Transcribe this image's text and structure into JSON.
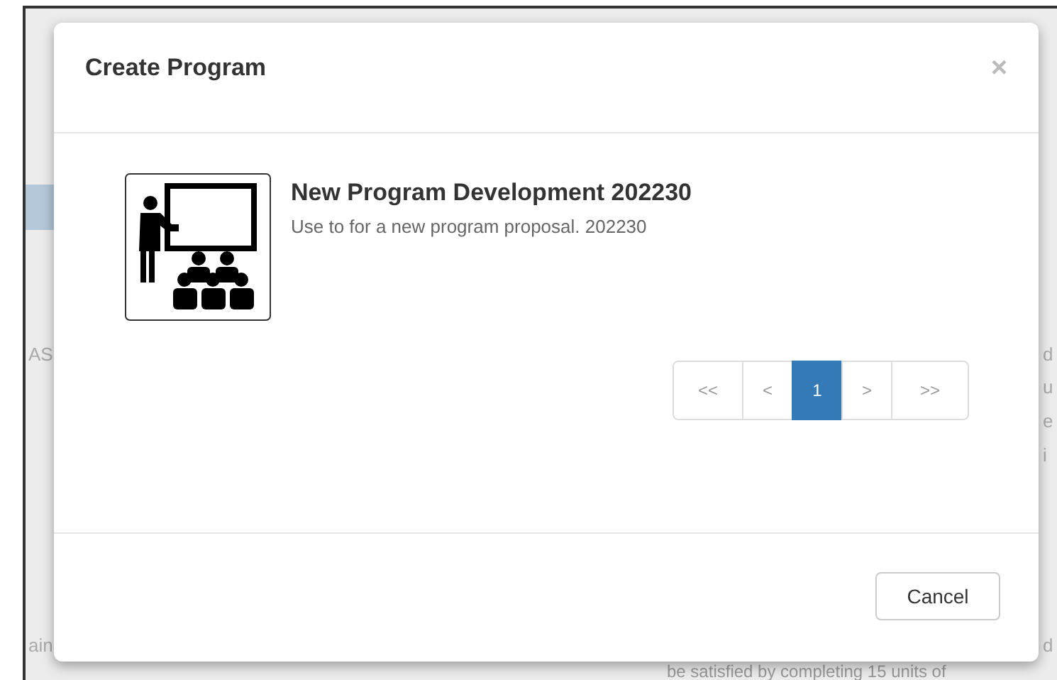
{
  "background": {
    "left_fragments": [
      "AS",
      "ain"
    ],
    "right_fragments": [
      "d",
      "u",
      "e",
      "i",
      "d"
    ],
    "bottom_text": "be satisfied by completing 15 units of"
  },
  "dialog": {
    "title": "Create Program",
    "close": "×",
    "items": [
      {
        "title": "New Program Development 202230",
        "description": "Use to for a new program proposal. 202230"
      }
    ],
    "pagination": [
      {
        "label": "<<",
        "selected": false
      },
      {
        "label": "<",
        "selected": false
      },
      {
        "label": "1",
        "selected": true
      },
      {
        "label": ">",
        "selected": false
      },
      {
        "label": ">>",
        "selected": false
      }
    ],
    "buttons": [
      "Cancel"
    ]
  }
}
